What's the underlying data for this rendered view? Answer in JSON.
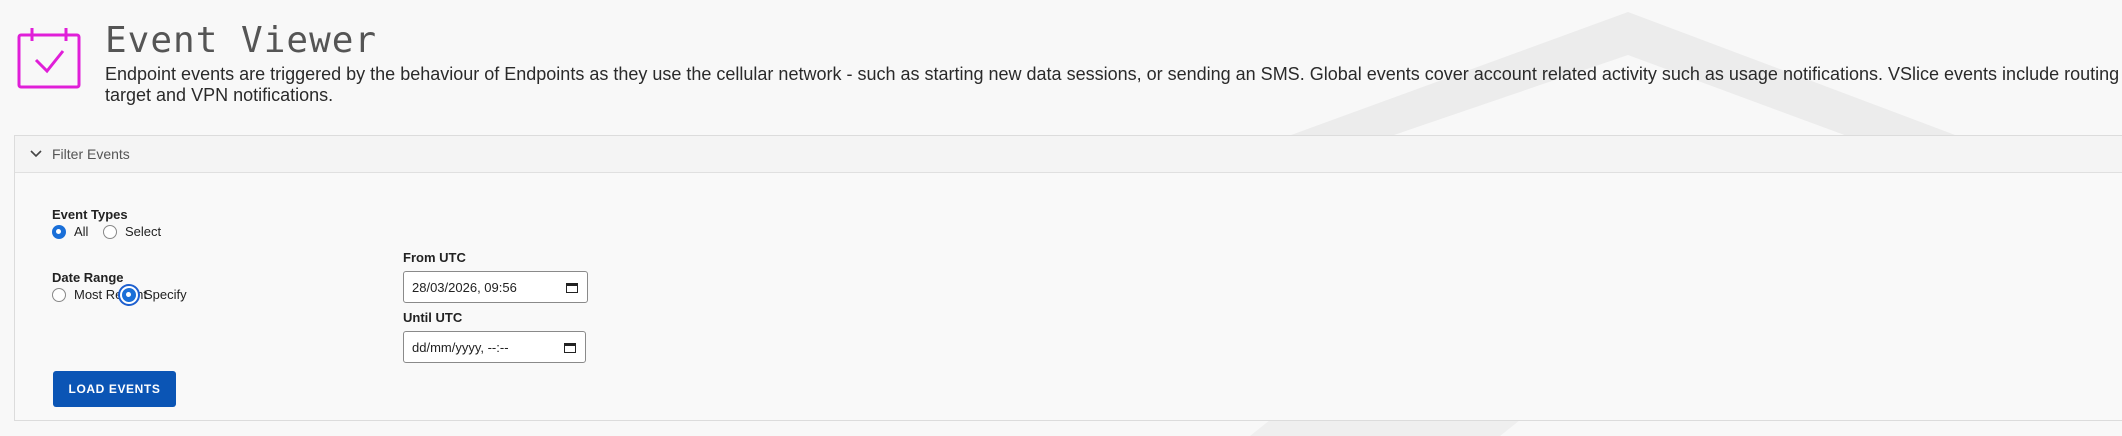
{
  "header": {
    "title": "Event Viewer",
    "description": "Endpoint events are triggered by the behaviour of Endpoints as they use the cellular network - such as starting new data sessions, or sending an SMS. Global events cover account related activity such as usage notifications. VSlice events include routing target and VPN notifications.",
    "icon": "calendar-check-icon",
    "accent_color": "#e01fd8"
  },
  "filter_panel": {
    "title": "Filter Events",
    "expanded": true,
    "event_types": {
      "label": "Event Types",
      "options": [
        "All",
        "Select"
      ],
      "selected": "All"
    },
    "date_range": {
      "label": "Date Range",
      "options": [
        "Most Recent",
        "Specify"
      ],
      "selected": "Specify"
    },
    "from_utc": {
      "label": "From UTC",
      "value": "28/03/2026, 09:56"
    },
    "until_utc": {
      "label": "Until UTC",
      "value": "dd/mm/yyyy, --:--"
    },
    "load_button": "LOAD EVENTS",
    "button_color": "#0b55b5",
    "radio_color": "#1a6fd8"
  }
}
